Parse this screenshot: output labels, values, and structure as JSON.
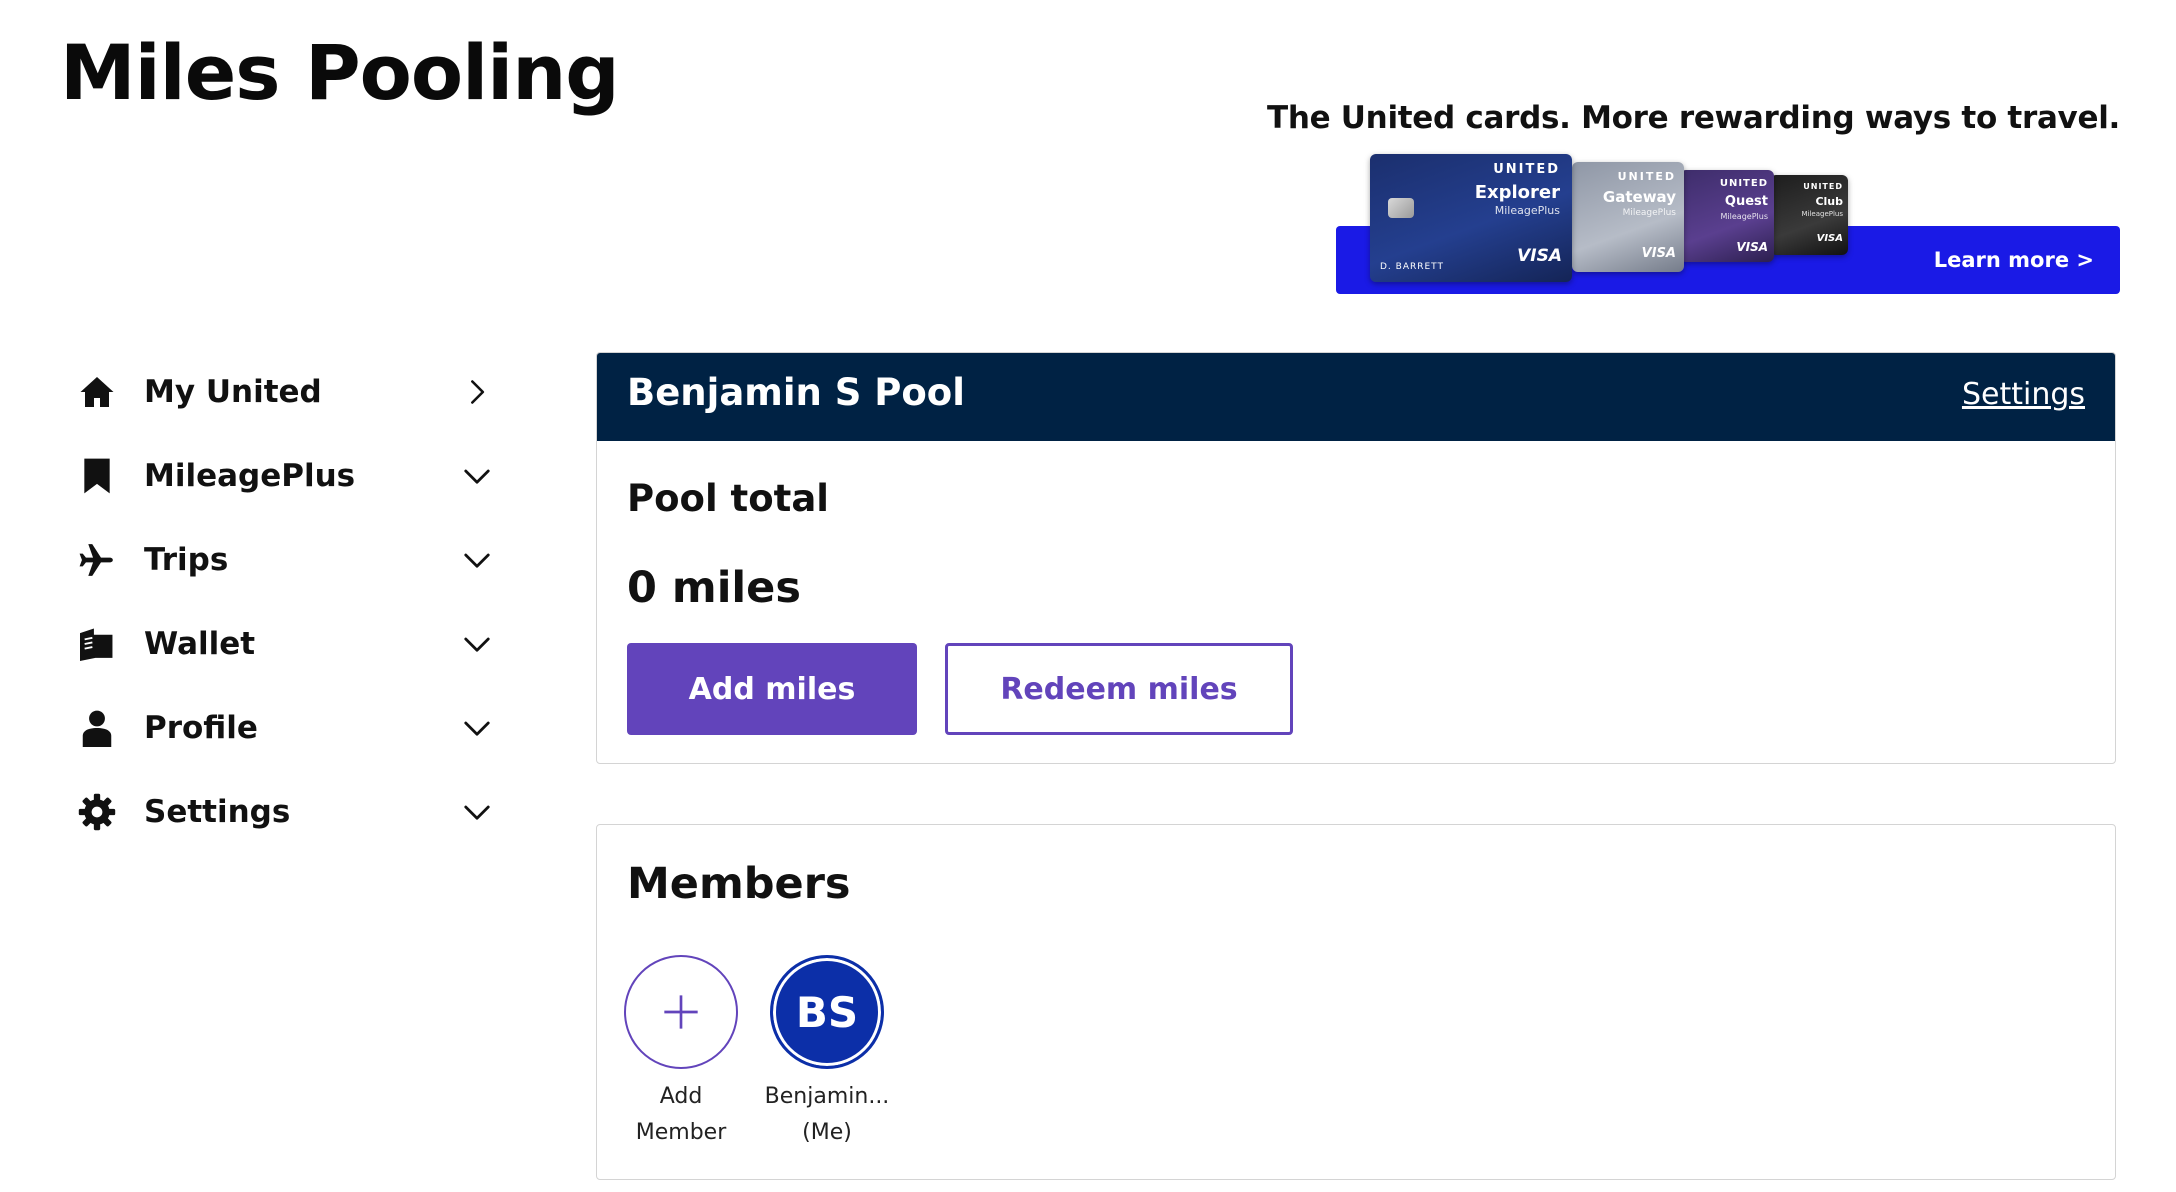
{
  "page": {
    "title": "Miles Pooling"
  },
  "promo": {
    "headline": "The United cards. More rewarding ways to travel.",
    "learn_more": "Learn more >",
    "bar_color": "#1a1ae6",
    "cards": [
      {
        "brand": "UNITED",
        "tier": "Explorer",
        "program": "MileagePlus",
        "network": "VISA",
        "holder": "D. BARRETT"
      },
      {
        "brand": "UNITED",
        "tier": "Gateway",
        "program": "MileagePlus",
        "network": "VISA"
      },
      {
        "brand": "UNITED",
        "tier": "Quest",
        "program": "MileagePlus",
        "network": "VISA"
      },
      {
        "brand": "UNITED",
        "tier": "Club",
        "program": "MileagePlus",
        "network": "VISA"
      }
    ]
  },
  "sidebar": {
    "items": [
      {
        "label": "My United",
        "icon": "home-icon",
        "indicator": "chevron-right"
      },
      {
        "label": "MileagePlus",
        "icon": "bookmark-icon",
        "indicator": "chevron-down"
      },
      {
        "label": "Trips",
        "icon": "airplane-icon",
        "indicator": "chevron-down"
      },
      {
        "label": "Wallet",
        "icon": "wallet-icon",
        "indicator": "chevron-down"
      },
      {
        "label": "Profile",
        "icon": "person-icon",
        "indicator": "chevron-down"
      },
      {
        "label": "Settings",
        "icon": "gear-icon",
        "indicator": "chevron-down"
      }
    ]
  },
  "pool": {
    "name": "Benjamin S Pool",
    "settings_link": "Settings",
    "total_label": "Pool total",
    "total_value": "0 miles",
    "add_button": "Add miles",
    "redeem_button": "Redeem miles",
    "header_color": "#002244",
    "accent_color": "#6244bb"
  },
  "members": {
    "title": "Members",
    "add": {
      "icon": "plus-icon",
      "line1": "Add",
      "line2": "Member"
    },
    "list": [
      {
        "initials": "BS",
        "line1": "Benjamin...",
        "line2": "(Me)",
        "avatar_color": "#0c2fa8"
      }
    ]
  }
}
